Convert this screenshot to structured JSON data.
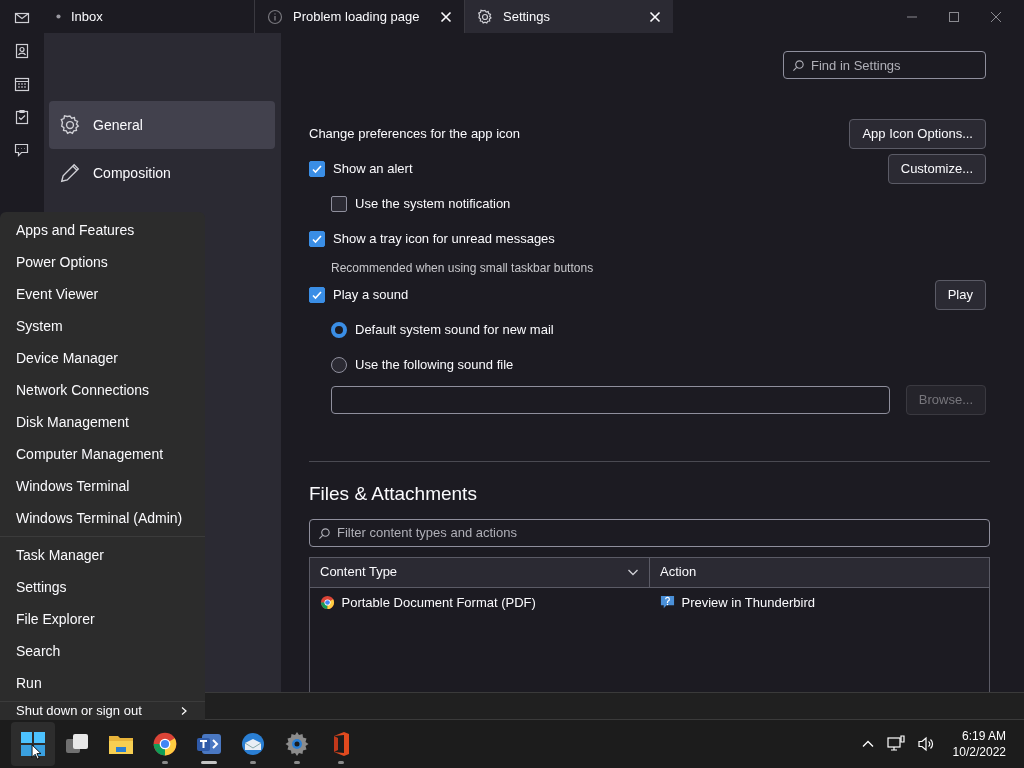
{
  "tabs": [
    {
      "label": "Inbox",
      "kind": "mail",
      "selected": false,
      "closable": false
    },
    {
      "label": "Problem loading page",
      "kind": "error",
      "selected": false,
      "closable": true
    },
    {
      "label": "Settings",
      "kind": "settings",
      "selected": true,
      "closable": true
    }
  ],
  "sidebar": {
    "items": [
      {
        "label": "General",
        "kind": "general",
        "selected": true
      },
      {
        "label": "Composition",
        "kind": "composition",
        "selected": false
      }
    ]
  },
  "search": {
    "placeholder": "Find in Settings"
  },
  "app_icon": {
    "heading": "Change preferences for the app icon",
    "button": "App Icon Options..."
  },
  "notifications": [
    {
      "kind": "checkbox",
      "label": "Show an alert",
      "checked": true,
      "button": {
        "label": "Customize...",
        "disabled": false
      },
      "children": [
        {
          "kind": "checkbox",
          "label": "Use the system notification",
          "checked": false
        }
      ]
    },
    {
      "kind": "checkbox",
      "label": "Show a tray icon for unread messages",
      "checked": true,
      "note": "Recommended when using small taskbar buttons"
    },
    {
      "kind": "checkbox",
      "label": "Play a sound",
      "checked": true,
      "button": {
        "label": "Play",
        "disabled": false
      },
      "children": [
        {
          "kind": "radio",
          "label": "Default system sound for new mail",
          "selected": true
        },
        {
          "kind": "radio",
          "label": "Use the following sound file",
          "selected": false
        },
        {
          "kind": "file",
          "button": {
            "label": "Browse...",
            "disabled": true
          }
        }
      ]
    }
  ],
  "files": {
    "heading": "Files & Attachments",
    "filter": {
      "placeholder": "Filter content types and actions"
    },
    "table": {
      "columns": [
        {
          "label": "Content Type",
          "sorted": true
        },
        {
          "label": "Action",
          "sorted": false
        }
      ],
      "rows": [
        {
          "content_type": "Portable Document Format (PDF)",
          "action": "Preview in Thunderbird"
        }
      ]
    }
  },
  "context_menu": {
    "groups": [
      {
        "items": [
          {
            "label": "Apps and Features",
            "submenu": false
          },
          {
            "label": "Power Options",
            "submenu": false
          },
          {
            "label": "Event Viewer",
            "submenu": false
          },
          {
            "label": "System",
            "submenu": false
          },
          {
            "label": "Device Manager",
            "submenu": false
          },
          {
            "label": "Network Connections",
            "submenu": false
          },
          {
            "label": "Disk Management",
            "submenu": false
          },
          {
            "label": "Computer Management",
            "submenu": false
          },
          {
            "label": "Windows Terminal",
            "submenu": false
          },
          {
            "label": "Windows Terminal (Admin)",
            "submenu": false
          }
        ]
      },
      {
        "items": [
          {
            "label": "Task Manager",
            "submenu": false
          },
          {
            "label": "Settings",
            "submenu": false
          },
          {
            "label": "File Explorer",
            "submenu": false
          },
          {
            "label": "Search",
            "submenu": false
          },
          {
            "label": "Run",
            "submenu": false
          }
        ]
      },
      {
        "items": [
          {
            "label": "Shut down or sign out",
            "submenu": true
          }
        ]
      }
    ]
  },
  "taskbar": {
    "apps": [
      {
        "kind": "start",
        "running": false,
        "focused": false
      },
      {
        "kind": "taskview",
        "running": false,
        "focused": false
      },
      {
        "kind": "explorer",
        "running": false,
        "focused": false
      },
      {
        "kind": "chrome",
        "running": true,
        "focused": false
      },
      {
        "kind": "teams",
        "running": true,
        "focused": true
      },
      {
        "kind": "thunderbird",
        "running": true,
        "focused": false
      },
      {
        "kind": "settings",
        "running": true,
        "focused": false
      },
      {
        "kind": "office",
        "running": true,
        "focused": false
      }
    ],
    "clock": {
      "time": "6:19 AM",
      "date": "10/2/2022"
    }
  }
}
